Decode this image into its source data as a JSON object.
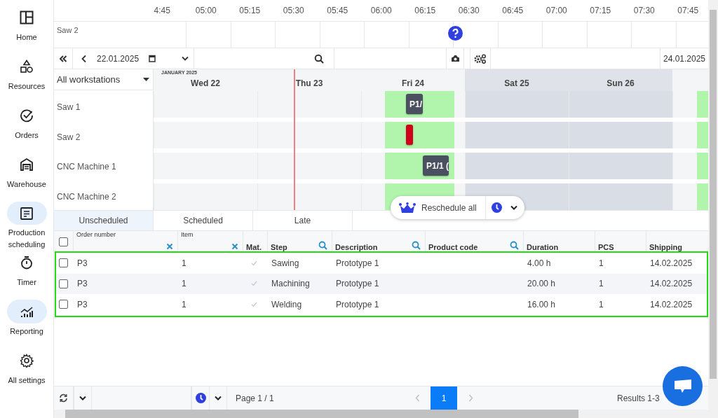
{
  "sidebar": {
    "items": [
      {
        "label": "Home",
        "selected": false
      },
      {
        "label": "Resources",
        "selected": false
      },
      {
        "label": "Orders",
        "selected": false
      },
      {
        "label": "Warehouse",
        "selected": false
      },
      {
        "label": "Production scheduling",
        "selected": true
      },
      {
        "label": "Timer",
        "selected": false
      },
      {
        "label": "Reporting",
        "selected": true
      },
      {
        "label": "All settings",
        "selected": false
      }
    ]
  },
  "timeline": {
    "times": [
      "4:45",
      "05:00",
      "05:15",
      "05:30",
      "05:45",
      "06:00",
      "06:15",
      "06:30",
      "06:45",
      "07:00",
      "07:15",
      "07:30",
      "07:45"
    ],
    "resource": "Saw 2"
  },
  "toolbar": {
    "start_date": "22.01.2025",
    "end_date": "24.01.2025"
  },
  "gantt": {
    "filter": "All workstations",
    "month": "JANUARY 2025",
    "days": [
      {
        "label": "Wed 22",
        "weekend": false
      },
      {
        "label": "Thu 23",
        "weekend": false
      },
      {
        "label": "Fri 24",
        "weekend": false
      },
      {
        "label": "Sat 25",
        "weekend": true
      },
      {
        "label": "Sun 26",
        "weekend": true
      }
    ],
    "rows": [
      {
        "name": "Saw 1",
        "tasks": [
          {
            "label": "P1/",
            "color": "#4a5060"
          }
        ]
      },
      {
        "name": "Saw 2",
        "tasks": [
          {
            "color": "#d0021b"
          }
        ]
      },
      {
        "name": "CNC Machine 1",
        "tasks": [
          {
            "label": "P1/1 (",
            "color": "#4a5060"
          }
        ]
      },
      {
        "name": "CNC Machine 2",
        "tasks": []
      }
    ]
  },
  "reschedule": {
    "label": "Reschedule all"
  },
  "tabs": [
    {
      "label": "Unscheduled",
      "selected": true
    },
    {
      "label": "Scheduled",
      "selected": false
    },
    {
      "label": "Late",
      "selected": false
    }
  ],
  "table": {
    "highlighted": true,
    "all_checked": false,
    "columns": [
      {
        "label": "Order number",
        "kind": "clearable"
      },
      {
        "label": "Item",
        "kind": "clearable"
      },
      {
        "label": "Mat.",
        "kind": "plain"
      },
      {
        "label": "Step",
        "kind": "searchable"
      },
      {
        "label": "Description",
        "kind": "searchable"
      },
      {
        "label": "Product code",
        "kind": "searchable"
      },
      {
        "label": "Duration",
        "kind": "plain"
      },
      {
        "label": "PCS",
        "kind": "plain"
      },
      {
        "label": "Shipping",
        "kind": "plain"
      }
    ],
    "rows": [
      {
        "checked": false,
        "order": "P3",
        "item": "1",
        "material": true,
        "step": "Sawing",
        "description": "Prototype 1",
        "duration": "4.00 h",
        "pcs": "1",
        "shipping": "14.02.2025"
      },
      {
        "checked": false,
        "order": "P3",
        "item": "1",
        "material": true,
        "step": "Machining",
        "description": "Prototype 1",
        "duration": "20.00 h",
        "pcs": "1",
        "shipping": "14.02.2025"
      },
      {
        "checked": false,
        "order": "P3",
        "item": "1",
        "material": true,
        "step": "Welding",
        "description": "Prototype 1",
        "duration": "16.00 h",
        "pcs": "1",
        "shipping": "14.02.2025"
      }
    ]
  },
  "pager": {
    "page_info": "Page 1 / 1",
    "pages": [
      {
        "label": "1",
        "selected": true
      }
    ],
    "results": "Results 1-3"
  }
}
